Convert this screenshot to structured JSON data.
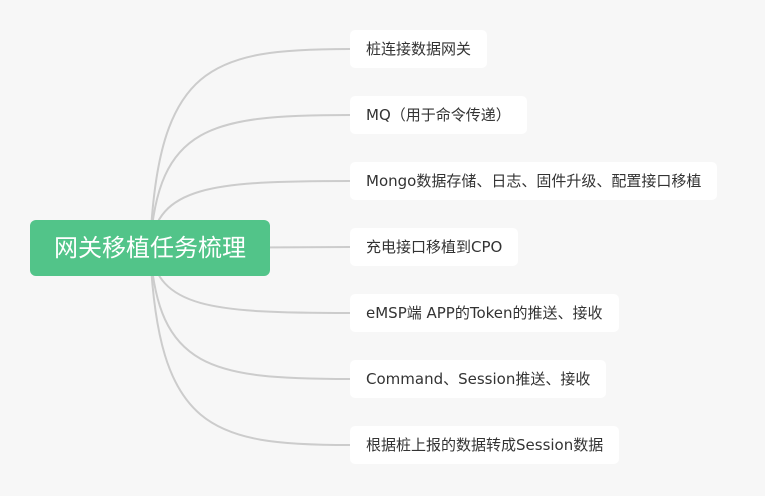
{
  "colors": {
    "background": "#f7f7f7",
    "root_fill": "#52c489",
    "root_text": "#ffffff",
    "node_fill": "#ffffff",
    "node_text": "#333333",
    "connector": "#cccccc"
  },
  "mindmap": {
    "root": {
      "label": "网关移植任务梳理"
    },
    "children": [
      {
        "label": "桩连接数据网关"
      },
      {
        "label": "MQ（用于命令传递）"
      },
      {
        "label": "Mongo数据存储、日志、固件升级、配置接口移植"
      },
      {
        "label": "充电接口移植到CPO"
      },
      {
        "label": "eMSP端 APP的Token的推送、接收"
      },
      {
        "label": "Command、Session推送、接收"
      },
      {
        "label": "根据桩上报的数据转成Session数据"
      }
    ]
  }
}
